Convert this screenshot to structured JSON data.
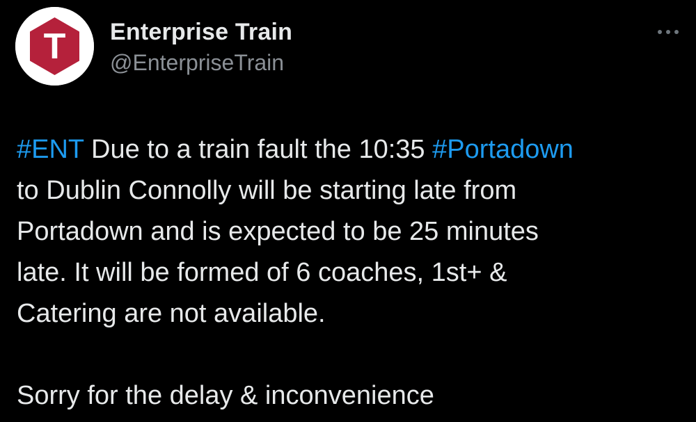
{
  "colors": {
    "background": "#000000",
    "text": "#e7e9ea",
    "secondary_text": "#8b9096",
    "link": "#1d9bf0",
    "avatar_ring": "#ffffff",
    "avatar_brand": "#b5213b"
  },
  "author": {
    "avatar_icon": "enterprise-t-logo-icon",
    "avatar_letter": "T",
    "display_name": "Enterprise Train",
    "handle": "@EnterpriseTrain"
  },
  "menu": {
    "icon": "more-options-icon"
  },
  "tweet": {
    "line1": {
      "hashtag1": "#ENT",
      "text1": " Due to a train fault the 10:35 ",
      "hashtag2": "#Portadown"
    },
    "line2": "to Dublin Connolly will be starting late from",
    "line3": "Portadown and is expected to be 25 minutes",
    "line4": "late. It will be formed of 6 coaches, 1st+ &",
    "line5": "Catering are not available.",
    "line6": "Sorry for the delay & inconvenience"
  }
}
